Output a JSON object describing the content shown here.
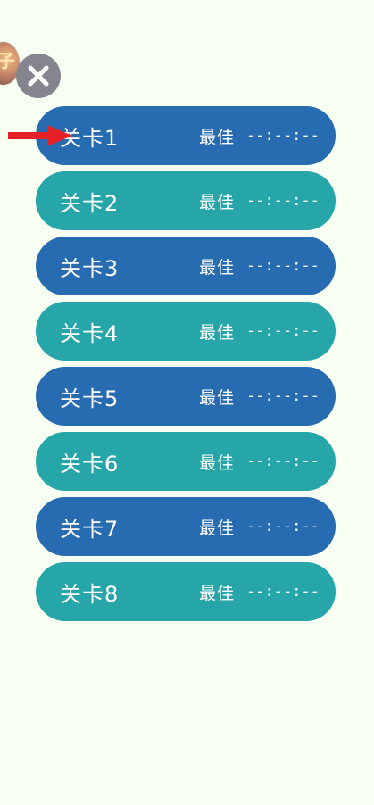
{
  "header": {
    "avatar_glyph": "子",
    "close_icon": "close-icon"
  },
  "levels": [
    {
      "label": "关卡1",
      "best_label": "最佳",
      "best_time": "--:--:--",
      "color": "#276bb0"
    },
    {
      "label": "关卡2",
      "best_label": "最佳",
      "best_time": "--:--:--",
      "color": "#27a6aa"
    },
    {
      "label": "关卡3",
      "best_label": "最佳",
      "best_time": "--:--:--",
      "color": "#276bb0"
    },
    {
      "label": "关卡4",
      "best_label": "最佳",
      "best_time": "--:--:--",
      "color": "#27a6aa"
    },
    {
      "label": "关卡5",
      "best_label": "最佳",
      "best_time": "--:--:--",
      "color": "#276bb0"
    },
    {
      "label": "关卡6",
      "best_label": "最佳",
      "best_time": "--:--:--",
      "color": "#27a6aa"
    },
    {
      "label": "关卡7",
      "best_label": "最佳",
      "best_time": "--:--:--",
      "color": "#276bb0"
    },
    {
      "label": "关卡8",
      "best_label": "最佳",
      "best_time": "--:--:--",
      "color": "#27a6aa"
    }
  ],
  "colors": {
    "background": "#f7fff3",
    "level_dark": "#276bb0",
    "level_teal": "#27a6aa",
    "close_button": "#85858f",
    "arrow": "#e52026"
  }
}
